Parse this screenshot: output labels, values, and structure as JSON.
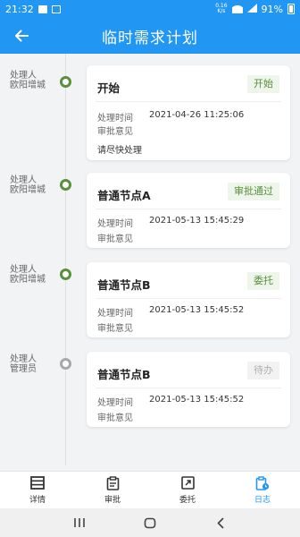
{
  "status_bar": {
    "time": "21:32",
    "speed_top": "0.16",
    "speed_bottom": "K/s",
    "battery": "91%"
  },
  "header": {
    "title": "临时需求计划"
  },
  "records": [
    {
      "handler_label": "处理人",
      "handler_name": "欧阳增城",
      "node": "开始",
      "status": "开始",
      "time_label": "处理时间",
      "time": "2021-04-26 11:25:06",
      "comment_label": "审批意见",
      "comment": "请尽快处理"
    },
    {
      "handler_label": "处理人",
      "handler_name": "欧阳增城",
      "node": "普通节点A",
      "status": "审批通过",
      "time_label": "处理时间",
      "time": "2021-05-13 15:45:29",
      "comment_label": "审批意见",
      "comment": ""
    },
    {
      "handler_label": "处理人",
      "handler_name": "欧阳增城",
      "node": "普通节点B",
      "status": "委托",
      "time_label": "处理时间",
      "time": "2021-05-13 15:45:52",
      "comment_label": "审批意见",
      "comment": ""
    },
    {
      "handler_label": "处理人",
      "handler_name": "管理员",
      "node": "普通节点B",
      "status": "待办",
      "time_label": "处理时间",
      "time": "2021-05-13 15:45:52",
      "comment_label": "审批意见",
      "comment": ""
    }
  ],
  "tabs": [
    {
      "label": "详情",
      "icon": "list-icon"
    },
    {
      "label": "审批",
      "icon": "clipboard-icon"
    },
    {
      "label": "委托",
      "icon": "external-link-icon"
    },
    {
      "label": "日志",
      "icon": "clipboard-clock-icon",
      "active": true
    }
  ],
  "colors": {
    "primary": "#2196f3",
    "done_green": "#5a8f3e",
    "pending_gray": "#a8a8a8"
  }
}
